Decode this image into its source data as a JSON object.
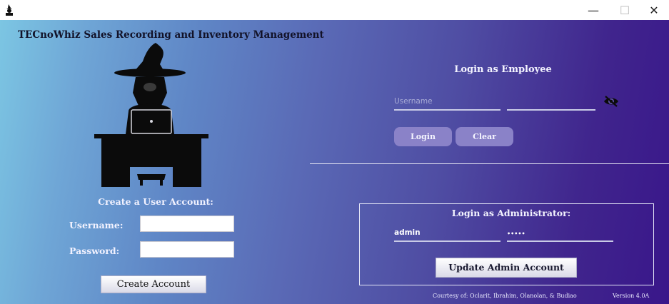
{
  "window": {
    "app_icon": "wizard-icon",
    "minimize_glyph": "—",
    "maximize_glyph": "☐",
    "close_glyph": "✕"
  },
  "app_title": "TECnoWhiz Sales Recording and Inventory Management",
  "mascot": {
    "icon": "wizard-at-desk-illustration"
  },
  "create_account": {
    "heading": "Create a User Account:",
    "username_label": "Username:",
    "password_label": "Password:",
    "username_value": "",
    "password_value": "",
    "button_label": "Create Account"
  },
  "employee_login": {
    "heading": "Login as Employee",
    "username_placeholder": "Username",
    "password_value": "",
    "visibility_icon": "eye-slash-icon",
    "login_label": "Login",
    "clear_label": "Clear"
  },
  "admin_login": {
    "heading": "Login as Administrator:",
    "username_value": "admin",
    "password_masked": "•••••",
    "update_label": "Update Admin Account"
  },
  "footer": {
    "courtesy": "Courtesy of: Oclarit, Ibrahim, Olanolan, & Budiao",
    "version": "Version 4.0A"
  },
  "colors": {
    "gradient_start": "#7cc6e3",
    "gradient_end": "#39168a",
    "pill_button": "#8a82c8"
  }
}
